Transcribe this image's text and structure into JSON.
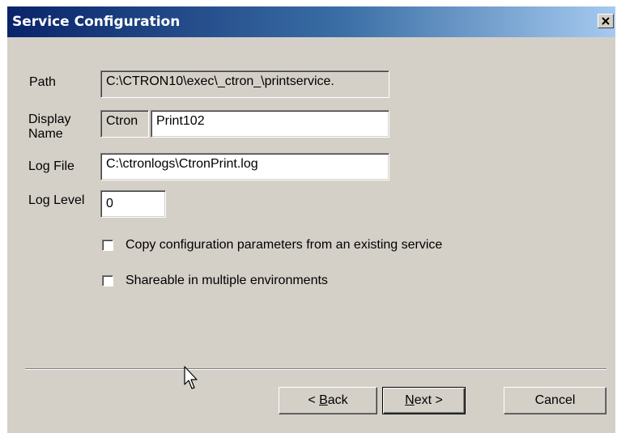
{
  "window": {
    "title": "Service Configuration",
    "close_glyph": "✕"
  },
  "form": {
    "path_label": "Path",
    "path_value": "C:\\CTRON10\\exec\\_ctron_\\printservice.",
    "display_name_label_line1": "Display",
    "display_name_label_line2": "Name",
    "display_name_prefix": "Ctron",
    "display_name_value": "Print102",
    "log_file_label": "Log File",
    "log_file_value": "C:\\ctronlogs\\CtronPrint.log",
    "log_level_label": "Log Level",
    "log_level_value": "0"
  },
  "options": {
    "copy_config": {
      "label": "Copy configuration parameters from an existing service",
      "checked": false
    },
    "shareable": {
      "label": "Shareable in multiple environments",
      "checked": false
    }
  },
  "buttons": {
    "back_prefix": "< ",
    "back_mnemonic": "B",
    "back_rest": "ack",
    "next_mnemonic": "N",
    "next_rest": "ext >",
    "cancel": "Cancel"
  },
  "colors": {
    "dialog_bg": "#d4d0c8",
    "title_start": "#0a246a",
    "title_end": "#a6caf0"
  }
}
